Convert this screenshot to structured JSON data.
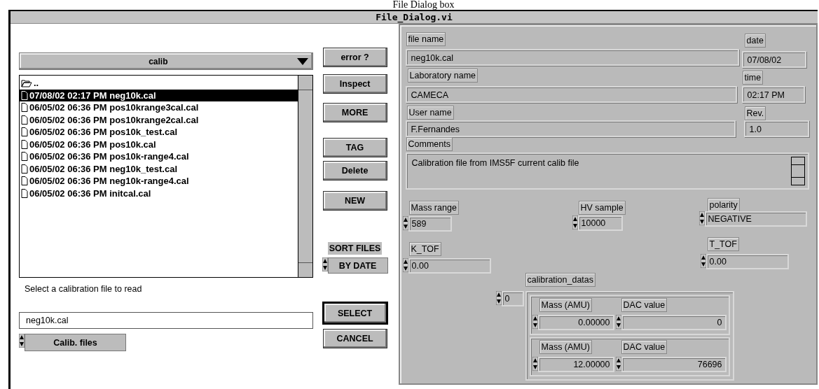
{
  "caption": "File Dialog box",
  "window": {
    "title": "File_Dialog.vi"
  },
  "folder_menu": {
    "value": "calib"
  },
  "file_list": [
    {
      "kind": "folder",
      "text": "..",
      "selected": false
    },
    {
      "kind": "file",
      "text": "07/08/02 02:17 PM neg10k.cal",
      "selected": true
    },
    {
      "kind": "file",
      "text": "06/05/02 06:36 PM pos10krange3cal.cal",
      "selected": false
    },
    {
      "kind": "file",
      "text": "06/05/02 06:36 PM pos10krange2cal.cal",
      "selected": false
    },
    {
      "kind": "file",
      "text": "06/05/02 06:36 PM pos10k_test.cal",
      "selected": false
    },
    {
      "kind": "file",
      "text": "06/05/02 06:36 PM pos10k.cal",
      "selected": false
    },
    {
      "kind": "file",
      "text": "06/05/02 06:36 PM pos10k-range4.cal",
      "selected": false
    },
    {
      "kind": "file",
      "text": "06/05/02 06:36 PM neg10k_test.cal",
      "selected": false
    },
    {
      "kind": "file",
      "text": "06/05/02 06:36 PM neg10k-range4.cal",
      "selected": false
    },
    {
      "kind": "file",
      "text": "06/05/02 06:36 PM initcal.cal",
      "selected": false
    }
  ],
  "side_buttons": [
    "error ?",
    "Inspect",
    "MORE",
    "TAG",
    "Delete",
    "NEW"
  ],
  "sort": {
    "label": "SORT FILES",
    "value": "BY DATE"
  },
  "prompt": "Select a calibration file to read",
  "filename_field": {
    "value": "neg10k.cal"
  },
  "filter_ring": {
    "value": "Calib. files"
  },
  "dialog_buttons": [
    {
      "label": "SELECT",
      "default": true
    },
    {
      "label": "CANCEL",
      "default": false
    }
  ],
  "info_fields": [
    {
      "label": "file name",
      "value": "neg10k.cal"
    },
    {
      "label": "date",
      "value": "07/08/02"
    },
    {
      "label": "Laboratory name",
      "value": "CAMECA"
    },
    {
      "label": "time",
      "value": "02:17 PM"
    },
    {
      "label": "User name",
      "value": "F.Fernandes"
    },
    {
      "label": "Rev.",
      "value": "1.0"
    }
  ],
  "comments": {
    "label": "Comments",
    "value": "Calibration file from IMS5F current calib file"
  },
  "numerics": [
    {
      "label": "Mass range",
      "value": "589"
    },
    {
      "label": "HV sample",
      "value": "10000"
    },
    {
      "label": "polarity",
      "value": "NEGATIVE"
    },
    {
      "label": "K_TOF",
      "value": "0.00"
    },
    {
      "label": "T_TOF",
      "value": "0.00"
    }
  ],
  "calibration_datas": {
    "label": "calibration_datas",
    "index": "0",
    "elements": [
      {
        "mass_label": "Mass (AMU)",
        "mass": "0.00000",
        "dac_label": "DAC value",
        "dac": "0"
      },
      {
        "mass_label": "Mass (AMU)",
        "mass": "12.00000",
        "dac_label": "DAC value",
        "dac": "76696"
      }
    ]
  }
}
